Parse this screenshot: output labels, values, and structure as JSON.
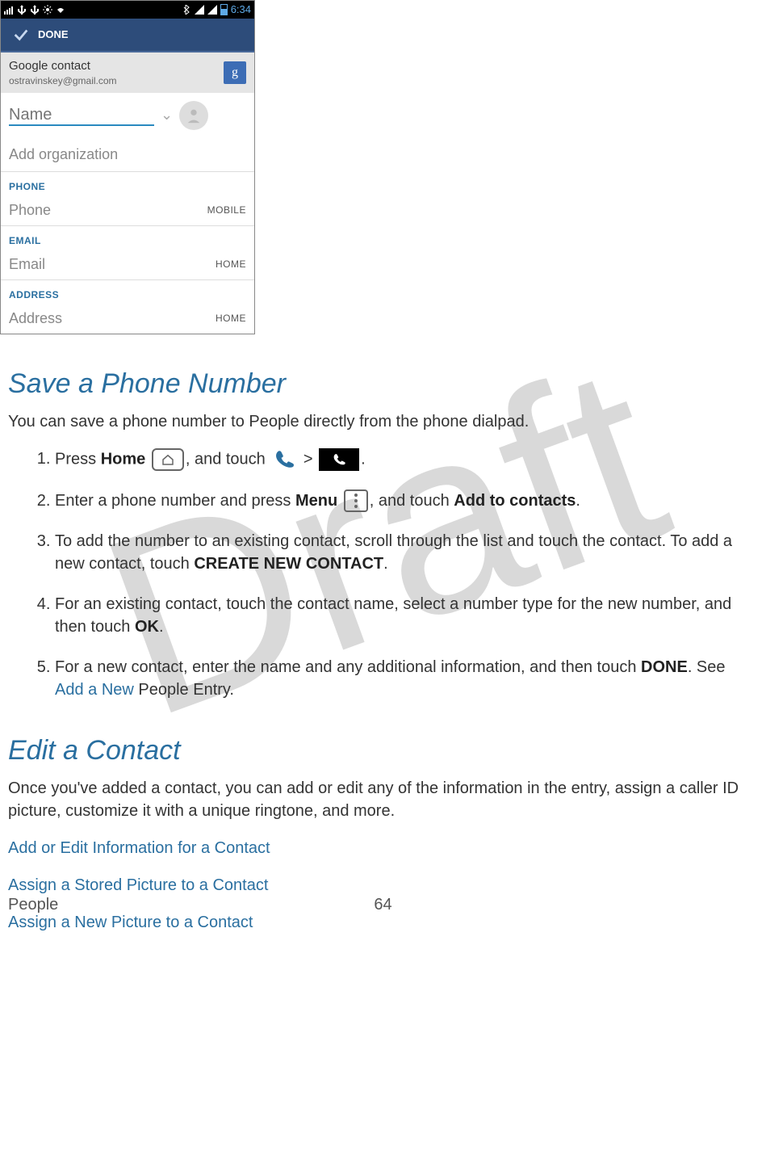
{
  "watermark": "Draft",
  "phone": {
    "time": "6:34",
    "done": "DONE",
    "account_title": "Google contact",
    "account_email": "ostravinskey@gmail.com",
    "g_label": "g",
    "name_placeholder": "Name",
    "add_org": "Add organization",
    "sections": {
      "phone": "PHONE",
      "email": "EMAIL",
      "address": "ADDRESS"
    },
    "fields": {
      "phone": "Phone",
      "phone_type": "MOBILE",
      "email": "Email",
      "email_type": "HOME",
      "address": "Address",
      "address_type": "HOME"
    }
  },
  "sections": {
    "save_title": "Save a Phone Number",
    "save_intro": "You can save a phone number to People directly from the phone dialpad.",
    "edit_title": "Edit a Contact",
    "edit_intro": "Once you've added a contact, you can add or edit any of the information in the entry, assign a caller ID picture, customize it with a unique ringtone, and more."
  },
  "steps": {
    "s1a": "Press ",
    "s1_home": "Home",
    "s1b": ", and touch ",
    "s1_gt": " > ",
    "s1c": ".",
    "s2a": "Enter a phone number and press ",
    "s2_menu": "Menu",
    "s2b": ", and touch ",
    "s2_add": "Add to contacts",
    "s2c": ".",
    "s3a": "To add the number to an existing contact, scroll through the list and touch the contact. To add a new contact, touch ",
    "s3_create": "CREATE NEW CONTACT",
    "s3b": ".",
    "s4a": "For an existing contact, touch the contact name, select a number type for the new number, and then touch ",
    "s4_ok": "OK",
    "s4b": ".",
    "s5a": "For a new contact, enter the name and any additional information, and then touch ",
    "s5_done": "DONE",
    "s5b": ". See ",
    "s5_link": "Add a New",
    "s5c": " People Entry."
  },
  "links": {
    "l1": "Add or Edit Information for a Contact",
    "l2": "Assign a Stored Picture to a Contact",
    "l3": "Assign a New Picture to a Contact"
  },
  "footer": {
    "section": "People",
    "page": "64"
  }
}
